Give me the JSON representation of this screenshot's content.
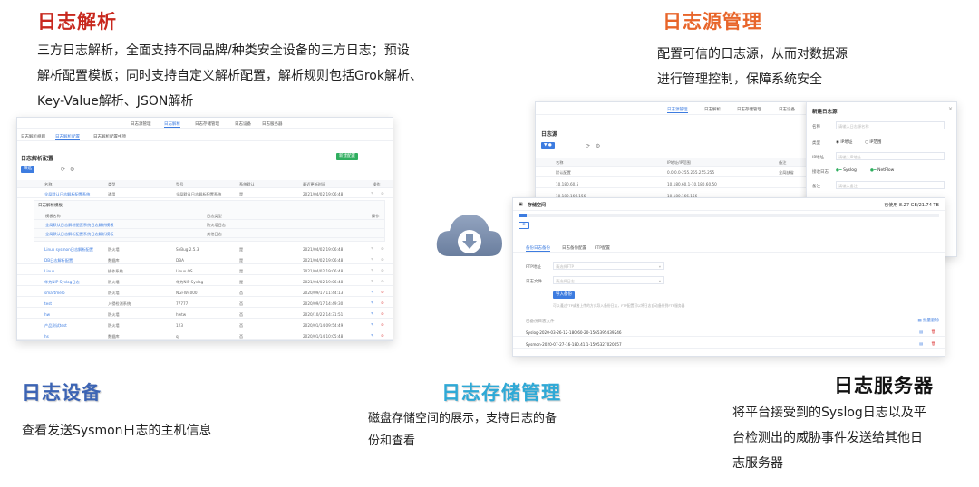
{
  "sections": {
    "log_parse": {
      "title": "日志解析",
      "desc_lines": [
        "三方日志解析，全面支持不同品牌/种类安全设备的三方日志；预设",
        "解析配置模板；同时支持自定义解析配置，解析规则包括Grok解析、",
        "Key-Value解析、JSON解析"
      ]
    },
    "log_source": {
      "title": "日志源管理",
      "desc_lines": [
        "配置可信的日志源，从而对数据源",
        "进行管理控制，保障系统安全"
      ]
    },
    "log_device": {
      "title": "日志设备",
      "desc_lines": [
        "查看发送Sysmon日志的主机信息"
      ]
    },
    "log_storage": {
      "title": "日志存储管理",
      "desc_lines": [
        "磁盘存储空间的展示，支持日志的备",
        "份和查看"
      ]
    },
    "log_server": {
      "title": "日志服务器",
      "desc_lines": [
        "将平台接受到的Syslog日志以及平",
        "台检测出的威胁事件发送给其他日",
        "志服务器"
      ]
    }
  },
  "parse_screenshot": {
    "top_tabs": [
      "日志源管理",
      "日志解析",
      "日志存储管理",
      "日志设备",
      "日志服务器"
    ],
    "sub_tabs": [
      "日志解析规则",
      "日志解析配置",
      "日志解析配置中项"
    ],
    "panel_title": "日志解析配置",
    "add_button": "新建配置",
    "filter_button": "筛选",
    "columns": [
      "名称",
      "类型",
      "型号",
      "系统默认",
      "最近更新时间",
      "操作"
    ],
    "rows": [
      [
        "全局默认日志解析配置系统",
        "通用",
        "全局默认日志解析配置系统",
        "是",
        "2021/04/02 19:06:48"
      ],
      [
        "Linux sysmon日志解析配置",
        "防火墙",
        "SeBug 2.5.3",
        "是",
        "2021/04/02 19:06:48"
      ],
      [
        "DB日志解析配置",
        "数据库",
        "DBA",
        "是",
        "2021/04/02 19:06:48"
      ],
      [
        "Linux",
        "操作系统",
        "Linux OS",
        "是",
        "2021/04/02 19:06:48"
      ],
      [
        "华为NIP Syslog日志",
        "防火墙",
        "华为NIP Syslog",
        "是",
        "2021/04/02 19:06:48"
      ],
      [
        "smartmelo",
        "防火墙",
        "NGFW4000",
        "否",
        "2020/09/17 11:44:13"
      ],
      [
        "test",
        "入侵检测系统",
        "77777",
        "否",
        "2020/09/17 14:49:30"
      ],
      [
        "hw",
        "防火墙",
        "hwtw",
        "否",
        "2020/10/22 14:31:51"
      ],
      [
        "产品测试test",
        "防火墙",
        "123",
        "否",
        "2020/01/14 09:54:49"
      ],
      [
        "hs",
        "数据库",
        "q",
        "否",
        "2020/01/14 10:05:48"
      ]
    ],
    "sub_panel_title": "日志解析模板",
    "sub_columns": [
      "模板名称",
      "日志类型",
      "操作"
    ],
    "sub_rows": [
      [
        "全局默认日志解析配置系统日志解析模板",
        "防火墙日志"
      ],
      [
        "全局默认日志解析配置系统日志解析模板",
        "其他日志"
      ]
    ]
  },
  "source_screenshot": {
    "top_tabs": [
      "日志源管理",
      "日志解析",
      "日志存储管理",
      "日志设备"
    ],
    "panel_title": "日志源",
    "columns": [
      "名称",
      "IP地址/IP范围",
      "备注"
    ],
    "rows": [
      [
        "默认配置",
        "0.0.0.0-255.255.255.255",
        "全局缺省"
      ],
      [
        "10.180.60.5",
        "10.180.60.1-10.180.60.50",
        ""
      ],
      [
        "10.180.166.156",
        "10.180.166.156",
        ""
      ]
    ],
    "drawer_title": "新建日志源",
    "drawer_fields": [
      {
        "label": "名称",
        "value": "请输入日志源名称"
      },
      {
        "label": "类型",
        "value": "IP地址"
      },
      {
        "label": "IP地址",
        "value": "请输入IP地址"
      },
      {
        "label": "接收日志",
        "value": "Syslog"
      },
      {
        "label": "备注",
        "value": "请输入备注"
      }
    ],
    "drawer_option_b": "IP范围",
    "drawer_option_c": "NetFlow"
  },
  "storage_screenshot": {
    "title": "存储空间",
    "usage": "已使用 8.27 GB/21.74 TB",
    "tabs": [
      "备份日志备份",
      "日志备份配置",
      "FTP配置"
    ],
    "fields": [
      {
        "label": "FTP地址",
        "value": "请选择FTP"
      },
      {
        "label": "日志文件",
        "value": "请选择日志"
      }
    ],
    "import_button": "导入备份",
    "hint": "可以通过FTP或者上传的方式导入备份日志，FTP配置可以将日志自动备份到FTP服务器",
    "list_label": "已备份日志文件",
    "list_action": "批量删除",
    "files": [
      "Syslog-2020-03-26-12-180.60-20-1565395439246",
      "Sysmon-2020-07-27-16-180.41.1-1595327020057"
    ]
  },
  "colors": {
    "red": "#c8281e",
    "orange": "#e8652a",
    "blue": "#3c64b4",
    "cyan": "#2fa9d6",
    "accent": "#3d7ce0",
    "cloud": "#7f93b2"
  }
}
